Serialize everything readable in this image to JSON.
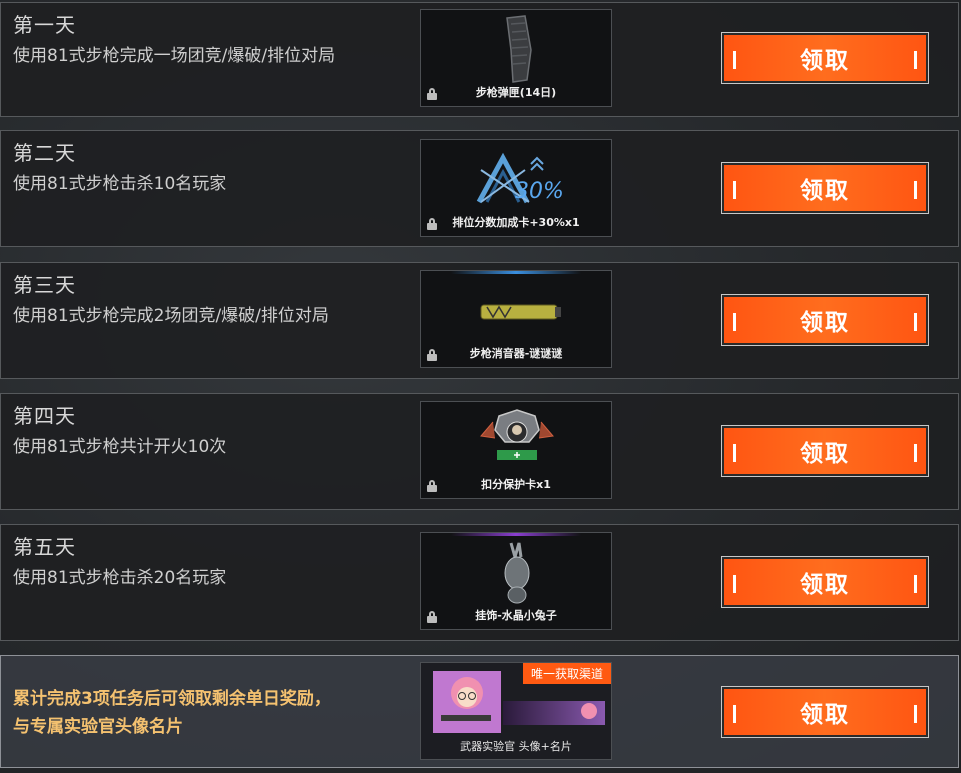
{
  "rows": [
    {
      "title": "第一天",
      "task": "使用81式步枪完成一场团竞/爆破/排位对局",
      "reward": "步枪弹匣(14日)",
      "button": "领取"
    },
    {
      "title": "第二天",
      "task": "使用81式步枪击杀10名玩家",
      "reward": "排位分数加成卡+30%x1",
      "button": "领取",
      "reward_art_text": "30%"
    },
    {
      "title": "第三天",
      "task": "使用81式步枪完成2场团竞/爆破/排位对局",
      "reward": "步枪消音器-谜谜谜",
      "button": "领取"
    },
    {
      "title": "第四天",
      "task": "使用81式步枪共计开火10次",
      "reward": "扣分保护卡x1",
      "button": "领取"
    },
    {
      "title": "第五天",
      "task": "使用81式步枪击杀20名玩家",
      "reward": "挂饰-水晶小兔子",
      "button": "领取"
    }
  ],
  "final": {
    "text": "累计完成3项任务后可领取剩余单日奖励， 与专属实验官头像名片",
    "badge": "唯一获取渠道",
    "reward": "武器实验官 头像+名片",
    "button": "领取"
  },
  "colors": {
    "accent": "#ff5a12",
    "final_text": "#f5c270",
    "rare_blue": "#3a8fe0",
    "rare_purple": "#8a3fd0"
  }
}
